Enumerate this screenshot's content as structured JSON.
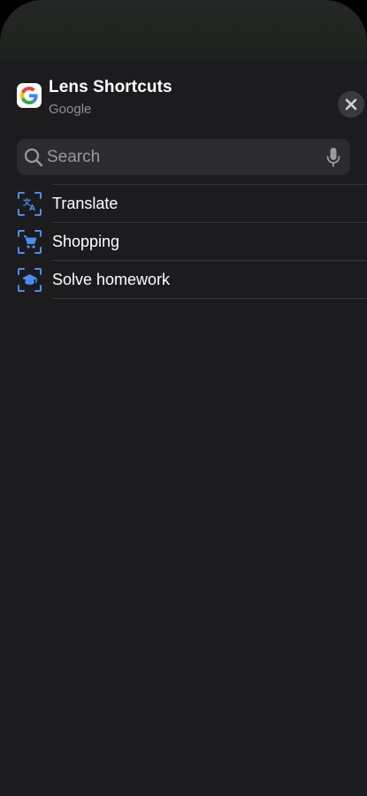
{
  "header": {
    "title": "Lens Shortcuts",
    "subtitle": "Google",
    "app_icon": "google-g-icon",
    "close_icon": "close-icon"
  },
  "search": {
    "placeholder": "Search",
    "value": "",
    "icon": "search-icon",
    "mic_icon": "microphone-icon"
  },
  "shortcuts": [
    {
      "label": "Translate",
      "icon": "translate-icon"
    },
    {
      "label": "Shopping",
      "icon": "shopping-cart-icon"
    },
    {
      "label": "Solve homework",
      "icon": "graduation-cap-icon"
    }
  ],
  "colors": {
    "sheet_background": "#1c1c1e",
    "accent_blue": "#4a8ef5",
    "search_field": "#2c2c2e",
    "secondary_text": "#8e8e93"
  }
}
